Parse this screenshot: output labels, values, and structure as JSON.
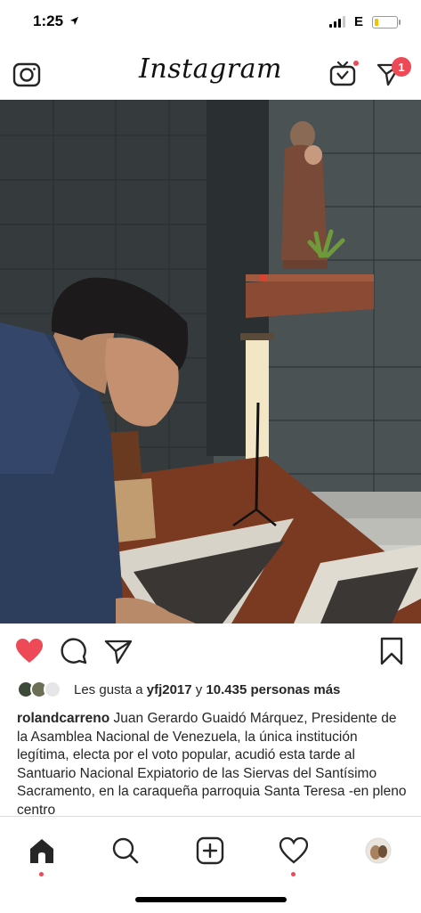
{
  "status": {
    "time": "1:25",
    "network": "E"
  },
  "header": {
    "brand": "Instagram",
    "badge_count": "1"
  },
  "post": {
    "likes": {
      "prefix": "Les gusta a",
      "user": "yfj2017",
      "connector": "y",
      "others": "10.435 personas más"
    },
    "caption": {
      "username": "rolandcarreno",
      "text": "Juan Gerardo Guaidó Márquez, Presidente de la  Asamblea Nacional de Venezuela, la única institución legítima, electa por el voto popular, acudió esta tarde al Santuario Nacional Expiatorio de las Siervas del Santísimo Sacramento, en la caraqueña parroquia Santa Teresa -en pleno centro"
    }
  },
  "colors": {
    "like_red": "#ed4956",
    "divider": "#dbdbdb",
    "text": "#262626"
  },
  "icons": {
    "header": [
      "camera-icon",
      "igtv-icon",
      "direct-icon"
    ],
    "actions": [
      "heart-filled-icon",
      "comment-icon",
      "share-icon",
      "bookmark-icon"
    ],
    "tabs": [
      "home-icon",
      "search-icon",
      "add-icon",
      "activity-icon",
      "profile-avatar"
    ]
  }
}
